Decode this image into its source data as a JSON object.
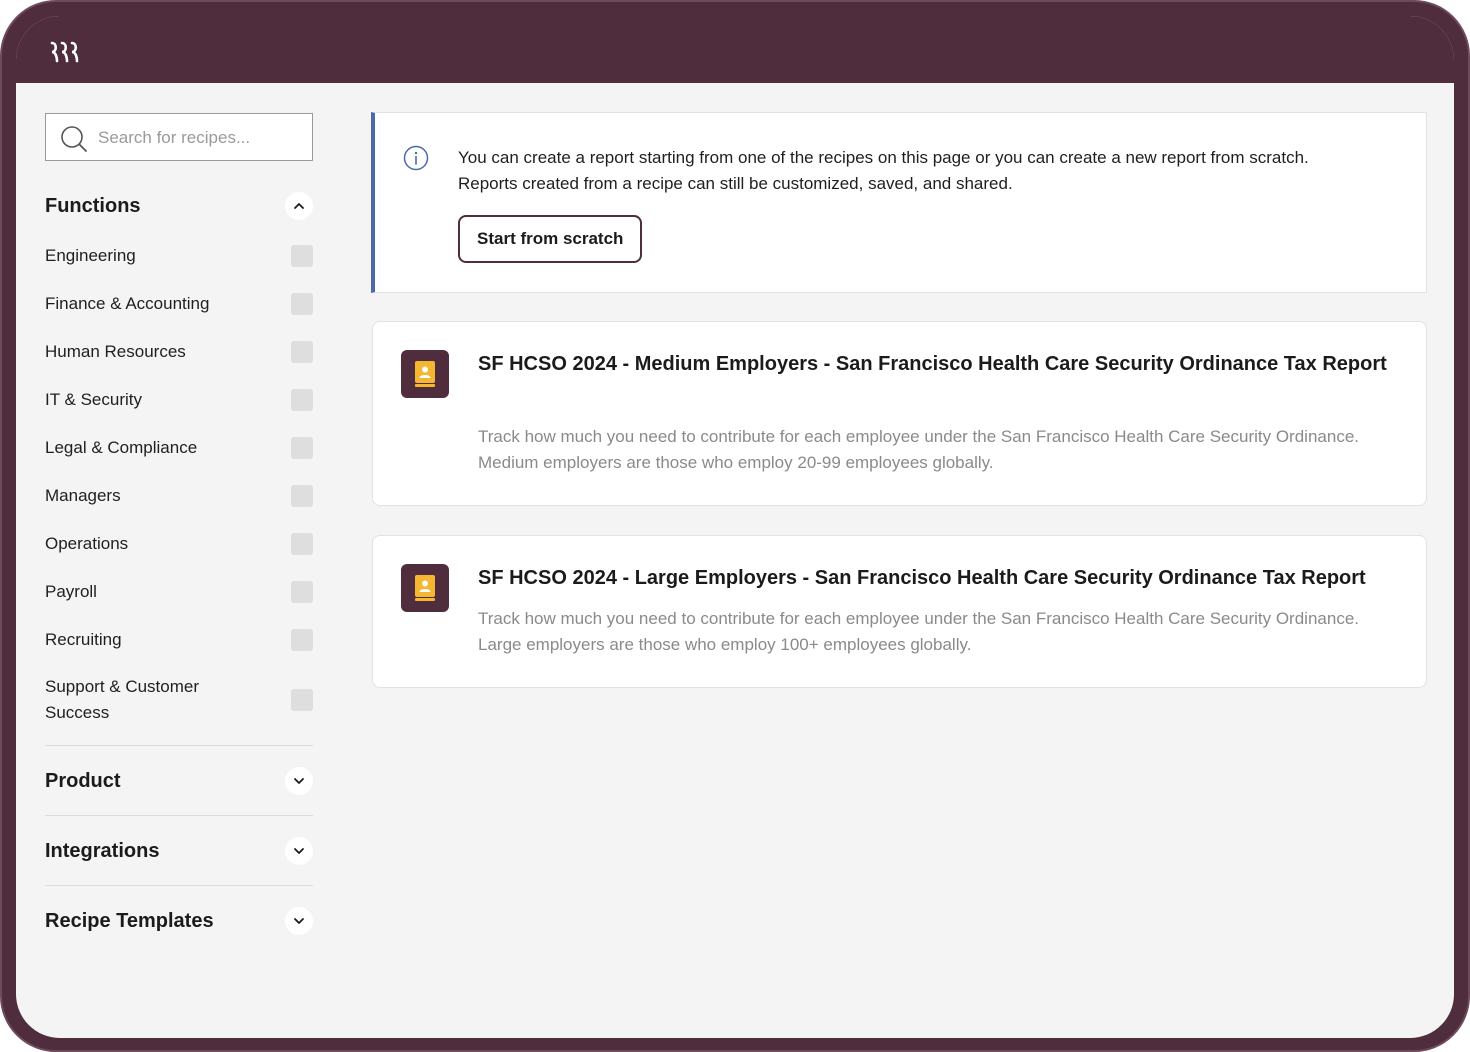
{
  "search": {
    "placeholder": "Search for recipes..."
  },
  "sidebar": {
    "functions": {
      "title": "Functions",
      "expanded": true,
      "items": [
        {
          "label": "Engineering",
          "checked": false
        },
        {
          "label": "Finance & Accounting",
          "checked": false
        },
        {
          "label": "Human Resources",
          "checked": false
        },
        {
          "label": "IT & Security",
          "checked": false
        },
        {
          "label": "Legal & Compliance",
          "checked": false
        },
        {
          "label": "Managers",
          "checked": false
        },
        {
          "label": "Operations",
          "checked": false
        },
        {
          "label": "Payroll",
          "checked": false
        },
        {
          "label": "Recruiting",
          "checked": false
        },
        {
          "label": "Support & Customer Success",
          "checked": false
        }
      ]
    },
    "sections": [
      {
        "title": "Product",
        "expanded": false
      },
      {
        "title": "Integrations",
        "expanded": false
      },
      {
        "title": "Recipe Templates",
        "expanded": false
      }
    ]
  },
  "info_banner": {
    "line1": "You can create a report starting from one of the recipes on this page or you can create a new report from scratch.",
    "line2": "Reports created from a recipe can still be customized, saved, and shared.",
    "button_label": "Start from scratch"
  },
  "recipes": [
    {
      "title": "SF HCSO 2024 - Medium Employers - San Francisco Health Care Security Ordinance Tax Report",
      "description": "Track how much you need to contribute for each employee under the San Francisco Health Care Security Ordinance. Medium employers are those who employ 20-99 employees globally."
    },
    {
      "title": "SF HCSO 2024 - Large Employers - San Francisco Health Care Security Ordinance Tax Report",
      "description": "Track how much you need to contribute for each employee under the San Francisco Health Care Security Ordinance. Large employers are those who employ 100+ employees globally."
    }
  ],
  "colors": {
    "brand": "#4f2d3d",
    "info_accent": "#4a6aa8",
    "recipe_icon": "#f5b731"
  },
  "icons": {
    "logo": "rippling-logo",
    "search": "search-icon",
    "info": "info-icon",
    "recipe": "contact-book-icon"
  }
}
